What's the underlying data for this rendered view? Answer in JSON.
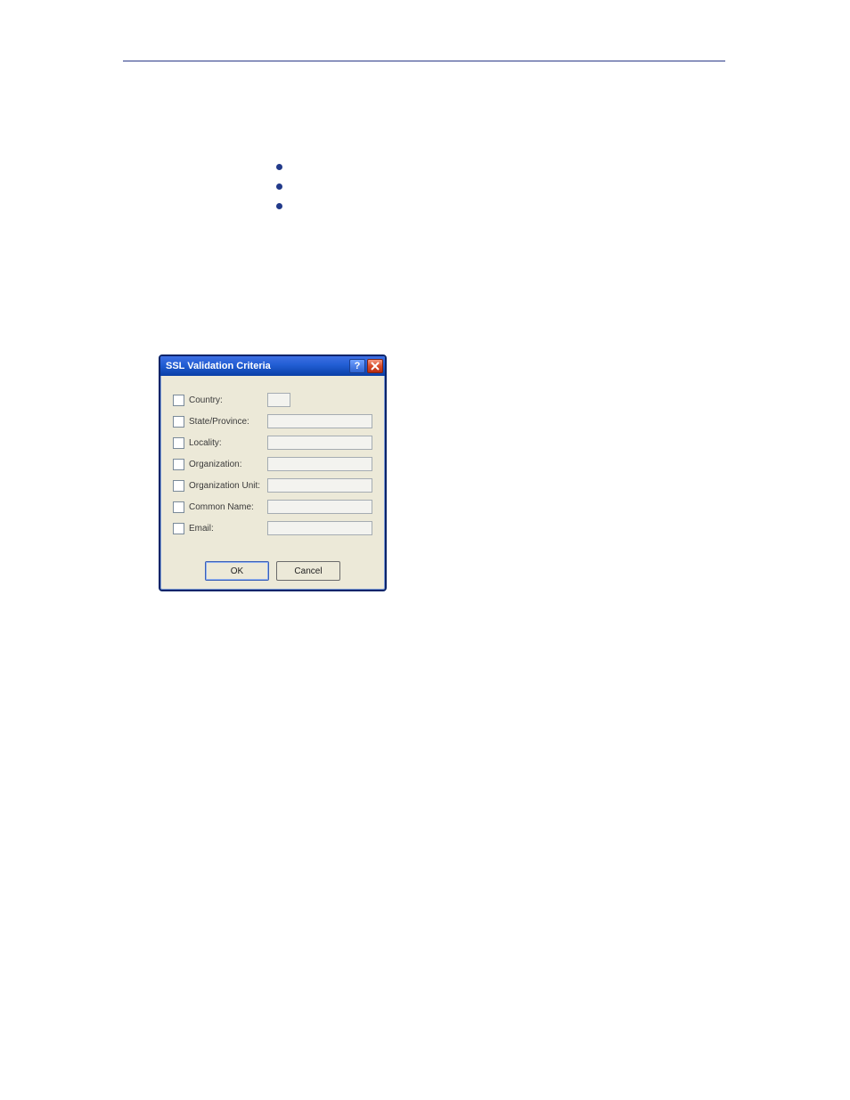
{
  "dialog": {
    "title": "SSL Validation Criteria",
    "fields": [
      {
        "label": "Country:"
      },
      {
        "label": "State/Province:"
      },
      {
        "label": "Locality:"
      },
      {
        "label": "Organization:"
      },
      {
        "label": "Organization Unit:"
      },
      {
        "label": "Common Name:"
      },
      {
        "label": "Email:"
      }
    ],
    "buttons": {
      "ok": "OK",
      "cancel": "Cancel"
    },
    "help_glyph": "?"
  }
}
